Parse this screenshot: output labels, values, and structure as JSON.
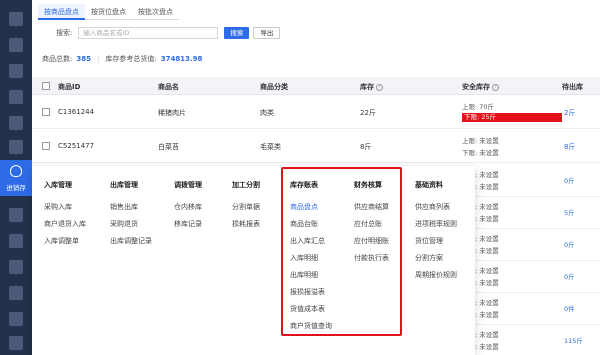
{
  "sidebar": {
    "active_label": "进销存"
  },
  "tabs": [
    "按商品盘点",
    "按货位盘点",
    "按批次盘点"
  ],
  "search": {
    "label": "搜索:",
    "placeholder": "输入商品名或ID",
    "search_btn": "搜索",
    "export_btn": "导出"
  },
  "summary": {
    "total_label": "商品总数:",
    "total_value": "385",
    "ref_label": "库存参考总货值:",
    "ref_value": "374813.98"
  },
  "table": {
    "headers": {
      "id": "商品ID",
      "name": "商品名",
      "category": "商品分类",
      "stock": "库存",
      "safety": "安全库存",
      "pending": "待出库"
    },
    "rows": [
      {
        "id": "C1361244",
        "name": "稀猪肉片",
        "category": "肉类",
        "stock": "22斤",
        "upper": "上限: 70斤",
        "lower": "下限: 25斤",
        "pending": "2斤"
      },
      {
        "id": "C5251477",
        "name": "白菜苔",
        "category": "毛菜类",
        "stock": "8斤",
        "upper": "上限: 未设置",
        "lower": "下限: 未设置",
        "pending": "8斤"
      }
    ],
    "right_rows": [
      {
        "upper": "上限: 未设置",
        "lower": "下限: 未设置",
        "pending": "0斤"
      },
      {
        "upper": "上限: 未设置",
        "lower": "下限: 未设置",
        "pending": "5斤"
      },
      {
        "upper": "上限: 未设置",
        "lower": "下限: 未设置",
        "pending": "0斤"
      },
      {
        "upper": "上限: 未设置",
        "lower": "下限: 未设置",
        "pending": "0斤"
      },
      {
        "upper": "上限: 未设置",
        "lower": "下限: 未设置",
        "pending": "0件"
      },
      {
        "upper": "上限: 未设置",
        "lower": "下限: 未设置",
        "pending": "115斤"
      }
    ]
  },
  "menu": {
    "columns": [
      {
        "title": "入库管理",
        "items": [
          "采购入库",
          "商户退货入库",
          "入库调整单"
        ]
      },
      {
        "title": "出库管理",
        "items": [
          "销售出库",
          "采购退货",
          "出库调整记录"
        ]
      },
      {
        "title": "调拨管理",
        "items": [
          "仓内移库",
          "移库记录"
        ]
      },
      {
        "title": "加工分割",
        "items": [
          "分割单据",
          "损耗报表"
        ]
      },
      {
        "title": "库存账表",
        "items": [
          "商品盘点",
          "商品台账",
          "出入库汇总",
          "入库明细",
          "出库明细",
          "报损报溢表",
          "货值成本表",
          "商户货值查询"
        ]
      },
      {
        "title": "财务核算",
        "items": [
          "供应商结算",
          "应付总账",
          "应付明细账",
          "付款执行表"
        ]
      },
      {
        "title": "基础资料",
        "items": [
          "供应商列表",
          "进项税率规则",
          "货位管理",
          "分割方案",
          "周期报价规则"
        ]
      }
    ]
  }
}
